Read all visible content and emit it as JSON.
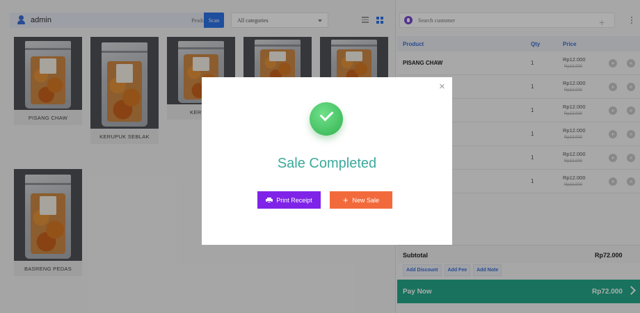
{
  "header": {
    "user": "admin",
    "search_placeholder": "Product",
    "scan_label": "Scan",
    "category_select": "All categories"
  },
  "products": [
    {
      "name": "PISANG CHAW"
    },
    {
      "name": "KERUPUK SEBLAK"
    },
    {
      "name": "KERIPIK"
    },
    {
      "name": ""
    },
    {
      "name": ""
    },
    {
      "name": "BASRENG PEDAS"
    }
  ],
  "cart": {
    "customer_placeholder": "Search customer",
    "columns": {
      "product": "Product",
      "qty": "Qty",
      "price": "Price"
    },
    "rows": [
      {
        "name": "PISANG CHAW",
        "qty": "1",
        "price": "Rp12.000",
        "old_price": "Rp13.000"
      },
      {
        "name": "",
        "qty": "1",
        "price": "Rp12.000",
        "old_price": "Rp13.000"
      },
      {
        "name": "",
        "qty": "1",
        "price": "Rp12.000",
        "old_price": "Rp13.000"
      },
      {
        "name": "",
        "qty": "1",
        "price": "Rp12.000",
        "old_price": "Rp13.000"
      },
      {
        "name": ".",
        "qty": "1",
        "price": "Rp12.000",
        "old_price": "Rp13.000"
      },
      {
        "name": "",
        "qty": "1",
        "price": "Rp12.000",
        "old_price": "Rp13.000"
      }
    ],
    "subtotal_label": "Subtotal",
    "subtotal_value": "Rp72.000",
    "add_discount": "Add Discount",
    "add_fee": "Add Fee",
    "add_note": "Add Note",
    "pay_now_label": "Pay Now",
    "pay_now_value": "Rp72.000"
  },
  "modal": {
    "title": "Sale Completed",
    "print_label": "Print Receipt",
    "new_sale_label": "New Sale",
    "close_glyph": "×"
  },
  "colors": {
    "scan": "#2d73e8",
    "pay_now": "#26a98a",
    "print_button": "#7f23e8",
    "new_sale_button": "#f26a3c",
    "modal_title": "#3aa99a"
  }
}
